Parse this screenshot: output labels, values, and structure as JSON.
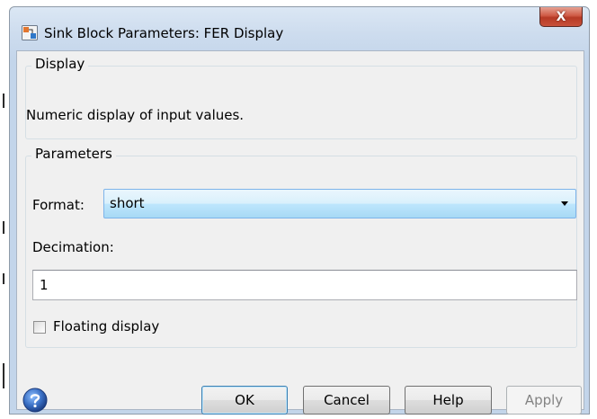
{
  "window": {
    "title": "Sink Block Parameters: FER Display",
    "close_symbol": "X",
    "icon": "simulink-block-icon"
  },
  "display_group": {
    "title": "Display",
    "description": "Numeric display of input values."
  },
  "parameters_group": {
    "title": "Parameters",
    "format_label": "Format:",
    "format_value": "short",
    "decimation_label": "Decimation:",
    "decimation_value": "1",
    "floating_display_label": "Floating display",
    "floating_display_checked": false
  },
  "buttons": {
    "ok": "OK",
    "cancel": "Cancel",
    "help": "Help",
    "apply": "Apply"
  },
  "colors": {
    "title_bar": "#cddcee",
    "close_button": "#c8513b",
    "dialog_background": "#f0f0f0",
    "select_highlight": "#bee6fd",
    "help_icon": "#3a6fc4"
  }
}
